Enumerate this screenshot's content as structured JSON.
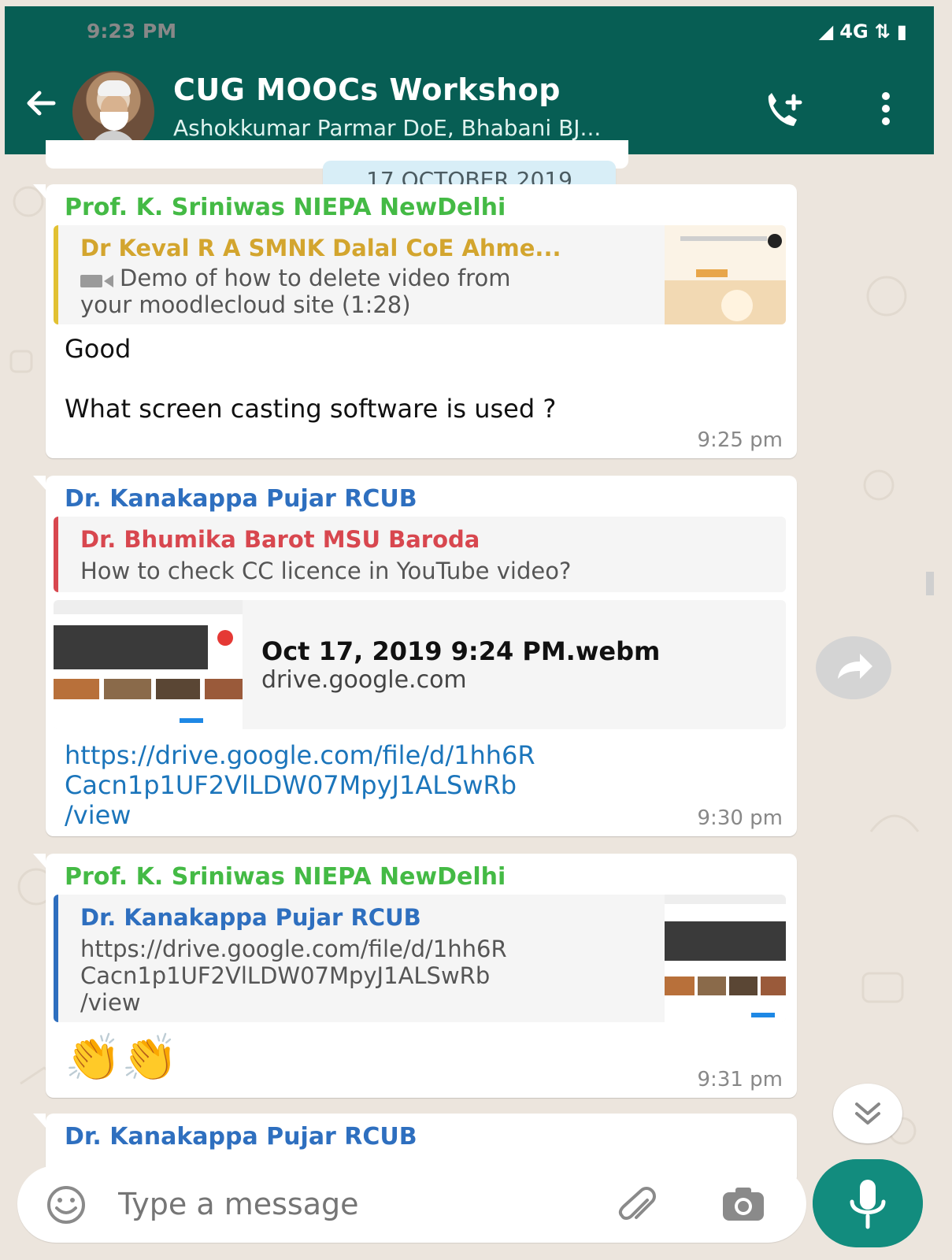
{
  "status": {
    "time": "9:23 PM",
    "network": "4G"
  },
  "header": {
    "title": "CUG MOOCs Workshop",
    "subtitle": "Ashokkumar Parmar DoE, Bhabani BJ..."
  },
  "chat": {
    "date": "17 OCTOBER 2019",
    "messages": [
      {
        "sender": "Prof. K. Sriniwas NIEPA NewDelhi",
        "reply_sender": "Dr Keval R A SMNK Dalal CoE Ahme...",
        "reply_text_line1": "Demo of how to delete video from",
        "reply_text_line2": "your moodlecloud site (1:28)",
        "text_line1": "Good",
        "text_line2": "What screen casting software is used ?",
        "time": "9:25 pm"
      },
      {
        "sender": "Dr. Kanakappa Pujar RCUB",
        "reply_sender": "Dr. Bhumika Barot MSU Baroda",
        "reply_text": "How to check CC licence in YouTube video?",
        "preview_title": "Oct 17, 2019 9:24 PM.webm",
        "preview_site": "drive.google.com",
        "link_line1": "https://drive.google.com/file/d/1hh6R",
        "link_line2": "Cacn1p1UF2VlLDW07MpyJ1ALSwRb",
        "link_line3": "/view",
        "time": "9:30 pm"
      },
      {
        "sender": "Prof. K. Sriniwas NIEPA NewDelhi",
        "reply_sender": "Dr. Kanakappa Pujar RCUB",
        "reply_text_line1": "https://drive.google.com/file/d/1hh6R",
        "reply_text_line2": "Cacn1p1UF2VlLDW07MpyJ1ALSwRb",
        "reply_text_line3": "/view",
        "emoji": "👏👏",
        "time": "9:31 pm"
      },
      {
        "sender": "Dr. Kanakappa Pujar RCUB"
      }
    ]
  },
  "composer": {
    "placeholder": "Type a message"
  },
  "colors": {
    "header": "#075e54",
    "accent": "#128c7e",
    "chat_bg": "#ece5dd"
  },
  "icons": [
    "back-arrow-icon",
    "add-call-icon",
    "more-vert-icon",
    "emoji-icon",
    "attach-icon",
    "camera-icon",
    "mic-icon",
    "forward-icon",
    "scroll-down-icon",
    "video-icon"
  ]
}
